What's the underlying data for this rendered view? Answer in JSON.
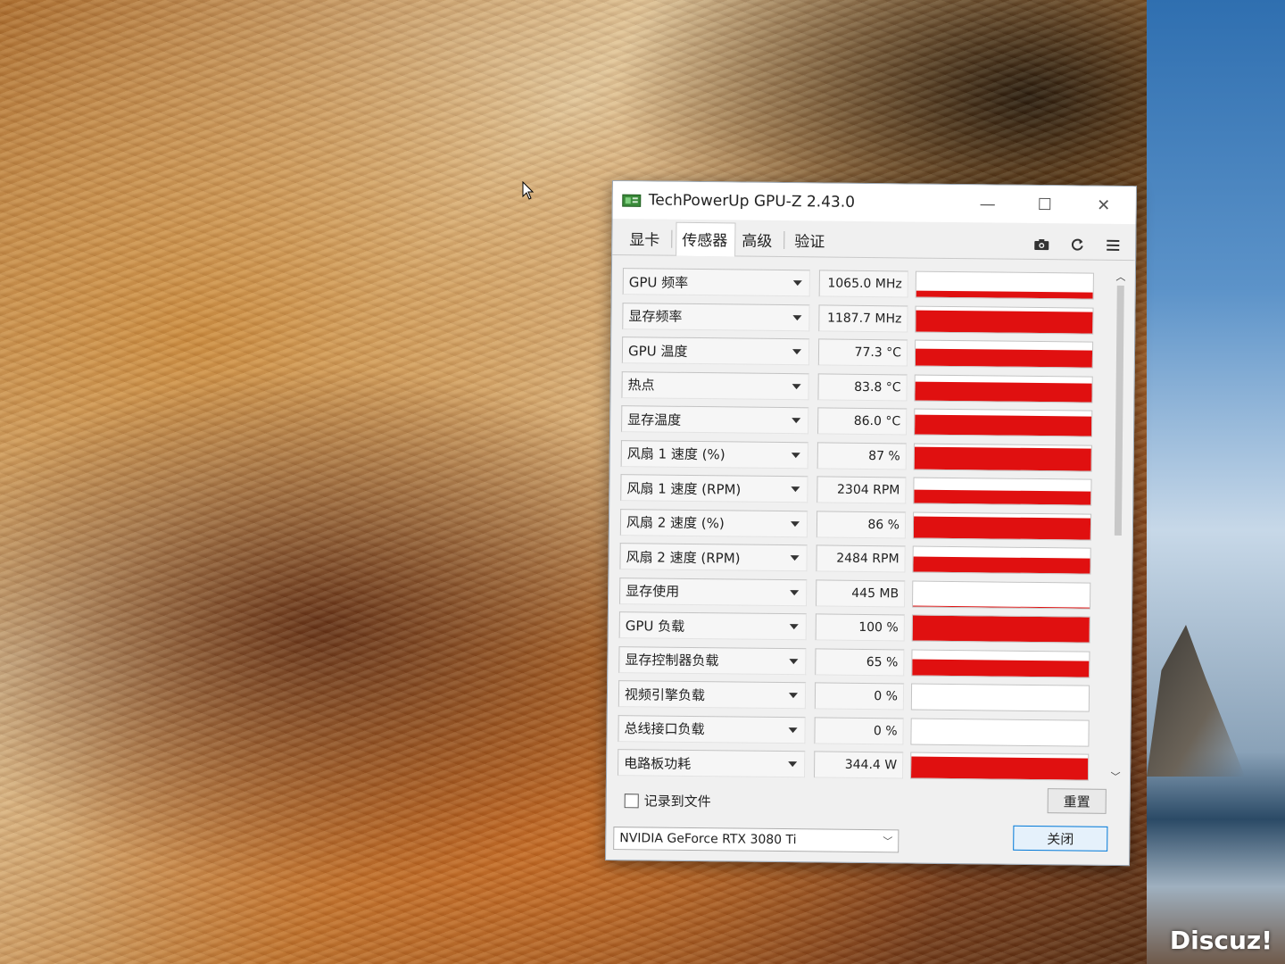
{
  "window": {
    "title": "TechPowerUp GPU-Z 2.43.0",
    "minimize_glyph": "—",
    "maximize_glyph": "☐",
    "close_glyph": "✕"
  },
  "tabs": [
    {
      "label": "显卡",
      "active": false
    },
    {
      "label": "传感器",
      "active": true
    },
    {
      "label": "高级",
      "active": false
    },
    {
      "label": "验证",
      "active": false
    }
  ],
  "toolbar": {
    "icons": [
      "camera-icon",
      "refresh-icon",
      "menu-icon"
    ]
  },
  "accent_colors": {
    "graph_fill": "#e01010",
    "button_focus": "#0078d7"
  },
  "sensors": [
    {
      "label": "GPU 频率",
      "value": "1065.0 MHz",
      "fill": 0.25
    },
    {
      "label": "显存频率",
      "value": "1187.7 MHz",
      "fill": 0.85
    },
    {
      "label": "GPU 温度",
      "value": "77.3 °C",
      "fill": 0.7
    },
    {
      "label": "热点",
      "value": "83.8 °C",
      "fill": 0.75
    },
    {
      "label": "显存温度",
      "value": "86.0 °C",
      "fill": 0.78
    },
    {
      "label": "风扇 1 速度 (%)",
      "value": "87 %",
      "fill": 0.87
    },
    {
      "label": "风扇 1 速度 (RPM)",
      "value": "2304 RPM",
      "fill": 0.55
    },
    {
      "label": "风扇 2 速度 (%)",
      "value": "86 %",
      "fill": 0.86
    },
    {
      "label": "风扇 2 速度 (RPM)",
      "value": "2484 RPM",
      "fill": 0.6
    },
    {
      "label": "显存使用",
      "value": "445 MB",
      "fill": 0.03
    },
    {
      "label": "GPU 负载",
      "value": "100 %",
      "fill": 1.0
    },
    {
      "label": "显存控制器负载",
      "value": "65 %",
      "fill": 0.65
    },
    {
      "label": "视频引擎负载",
      "value": "0 %",
      "fill": 0.0
    },
    {
      "label": "总线接口负载",
      "value": "0 %",
      "fill": 0.0
    },
    {
      "label": "电路板功耗",
      "value": "344.4 W",
      "fill": 0.85
    }
  ],
  "footer": {
    "log_to_file_label": "记录到文件",
    "log_to_file_checked": false,
    "reset_label": "重置",
    "gpu_select_value": "NVIDIA GeForce RTX 3080 Ti",
    "close_label": "关闭"
  },
  "watermark": "Discuz!"
}
